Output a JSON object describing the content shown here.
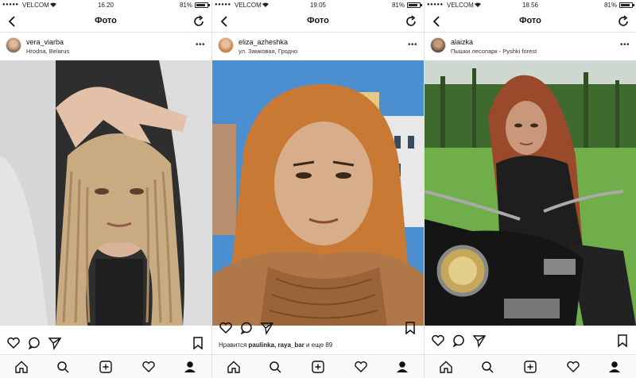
{
  "panels": [
    {
      "status": {
        "carrier": "VELCOM",
        "time": "16.20",
        "battery": "81%"
      },
      "nav": {
        "title": "Фото"
      },
      "post": {
        "username": "vera_viarba",
        "location": "Hrodna, Belarus",
        "likes_prefix": "",
        "likes_users": "",
        "likes_suffix": ""
      },
      "photo_desc": "woman with braided hair",
      "colors": {
        "bg": "#3a3a3a",
        "skin": "#d9b49a",
        "hair": "#c9ab82"
      }
    },
    {
      "status": {
        "carrier": "VELCOM",
        "time": "19.05",
        "battery": "81%"
      },
      "nav": {
        "title": "Фото"
      },
      "post": {
        "username": "eliza_azheshka",
        "location": "ул. Замковая, Гродно",
        "likes_prefix": "Нравится",
        "likes_users": "paulinka, raya_bar",
        "likes_suffix": "и еще 89"
      },
      "photo_desc": "woman in fur coat",
      "colors": {
        "bg": "#4b8fd0",
        "skin": "#d8ae8a",
        "hair": "#c87a35"
      }
    },
    {
      "status": {
        "carrier": "VELCOM",
        "time": "18.56",
        "battery": "81%"
      },
      "nav": {
        "title": "Фото"
      },
      "post": {
        "username": "alaizka",
        "location": "Пышки лесопарк - Pyshki forest",
        "likes_prefix": "",
        "likes_users": "",
        "likes_suffix": ""
      },
      "photo_desc": "woman on motorcycle in park",
      "colors": {
        "bg": "#5e9a3e",
        "skin": "#c9987a",
        "hair": "#9a4a2a"
      }
    }
  ],
  "icons": {
    "back": "chevron-left-icon",
    "refresh": "refresh-icon",
    "more": "more-icon",
    "like": "heart-icon",
    "comment": "comment-icon",
    "share": "send-icon",
    "save": "bookmark-icon",
    "tabs": [
      "home-icon",
      "search-icon",
      "add-icon",
      "heart-icon",
      "profile-icon"
    ]
  }
}
